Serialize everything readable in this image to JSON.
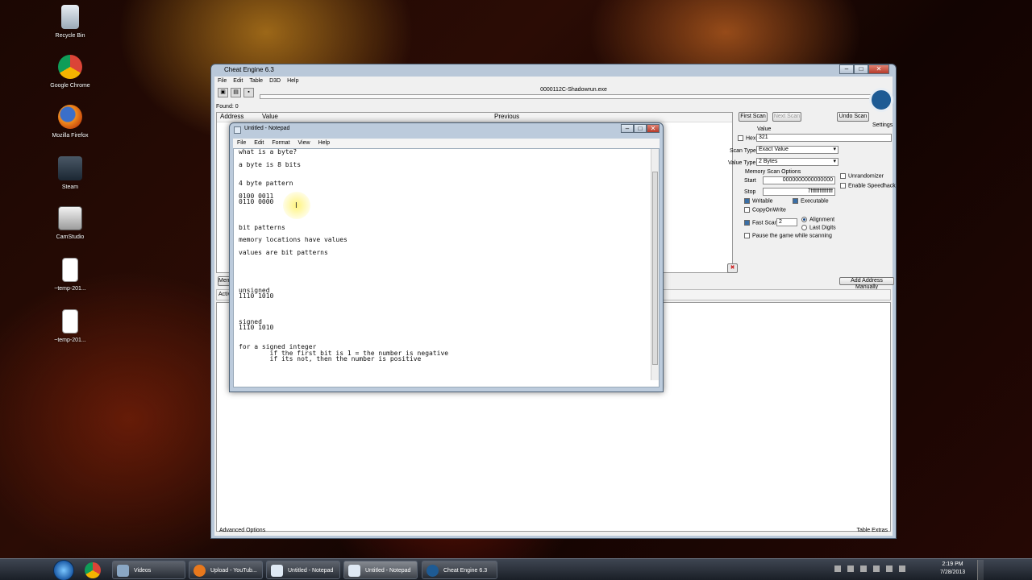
{
  "desktop": {
    "icons": [
      {
        "label": "Recycle Bin"
      },
      {
        "label": "Google Chrome"
      },
      {
        "label": "Mozilla Firefox"
      },
      {
        "label": "Steam"
      },
      {
        "label": "CamStudio"
      },
      {
        "label": "~temp-201..."
      },
      {
        "label": "~temp-201..."
      }
    ]
  },
  "cheat_engine": {
    "title": "Cheat Engine 6.3",
    "menu": [
      "File",
      "Edit",
      "Table",
      "D3D",
      "Help"
    ],
    "process": "0000112C-Shadowrun.exe",
    "found": "Found: 0",
    "columns": {
      "address": "Address",
      "value": "Value",
      "previous": "Previous"
    },
    "buttons": {
      "first_scan": "First Scan",
      "next_scan": "Next Scan",
      "undo_scan": "Undo Scan",
      "settings": "Settings",
      "add_address": "Add Address Manually",
      "memory_view": "Memory View"
    },
    "value_label": "Value",
    "hex_label": "Hex",
    "value": "321",
    "scan_type_label": "Scan Type",
    "scan_type": "Exact Value",
    "value_type_label": "Value Type",
    "value_type": "2 Bytes",
    "mem_options_label": "Memory Scan Options",
    "start_label": "Start",
    "start_value": "0000000000000000",
    "stop_label": "Stop",
    "stop_value": "7fffffffffffffff",
    "writable": "Writable",
    "executable": "Executable",
    "copy_on_write": "CopyOnWrite",
    "fast_scan": "Fast Scan",
    "fast_scan_value": "2",
    "alignment": "Alignment",
    "last_digits": "Last Digits",
    "pause_game": "Pause the game while scanning",
    "unrandomizer": "Unrandomizer",
    "enable_speedhack": "Enable Speedhack",
    "active_col": "Active",
    "advanced_options": "Advanced Options",
    "table_extras": "Table Extras"
  },
  "notepad": {
    "title": "Untitled - Notepad",
    "menu": [
      "File",
      "Edit",
      "Format",
      "View",
      "Help"
    ],
    "lines": [
      "what is a byte?",
      "",
      "a byte is 8 bits",
      "",
      "",
      "4 byte pattern",
      "",
      "0100 0011",
      "0110 0000",
      "",
      "",
      "",
      "bit patterns",
      "",
      "memory locations have values",
      "",
      "values are bit patterns",
      "",
      "",
      "",
      "",
      "",
      "unsigned",
      "1110 1010",
      "",
      "",
      "",
      "signed",
      "1110 1010",
      "",
      "",
      "for a signed integer",
      "        if the first bit is 1 = the number is negative",
      "        if its not, then the number is positive"
    ]
  },
  "taskbar": {
    "items": [
      "Videos",
      "Upload - YouTub...",
      "Untitled - Notepad",
      "Untitled - Notepad",
      "Cheat Engine 6.3"
    ],
    "time": "2:19 PM",
    "date": "7/28/2013"
  }
}
